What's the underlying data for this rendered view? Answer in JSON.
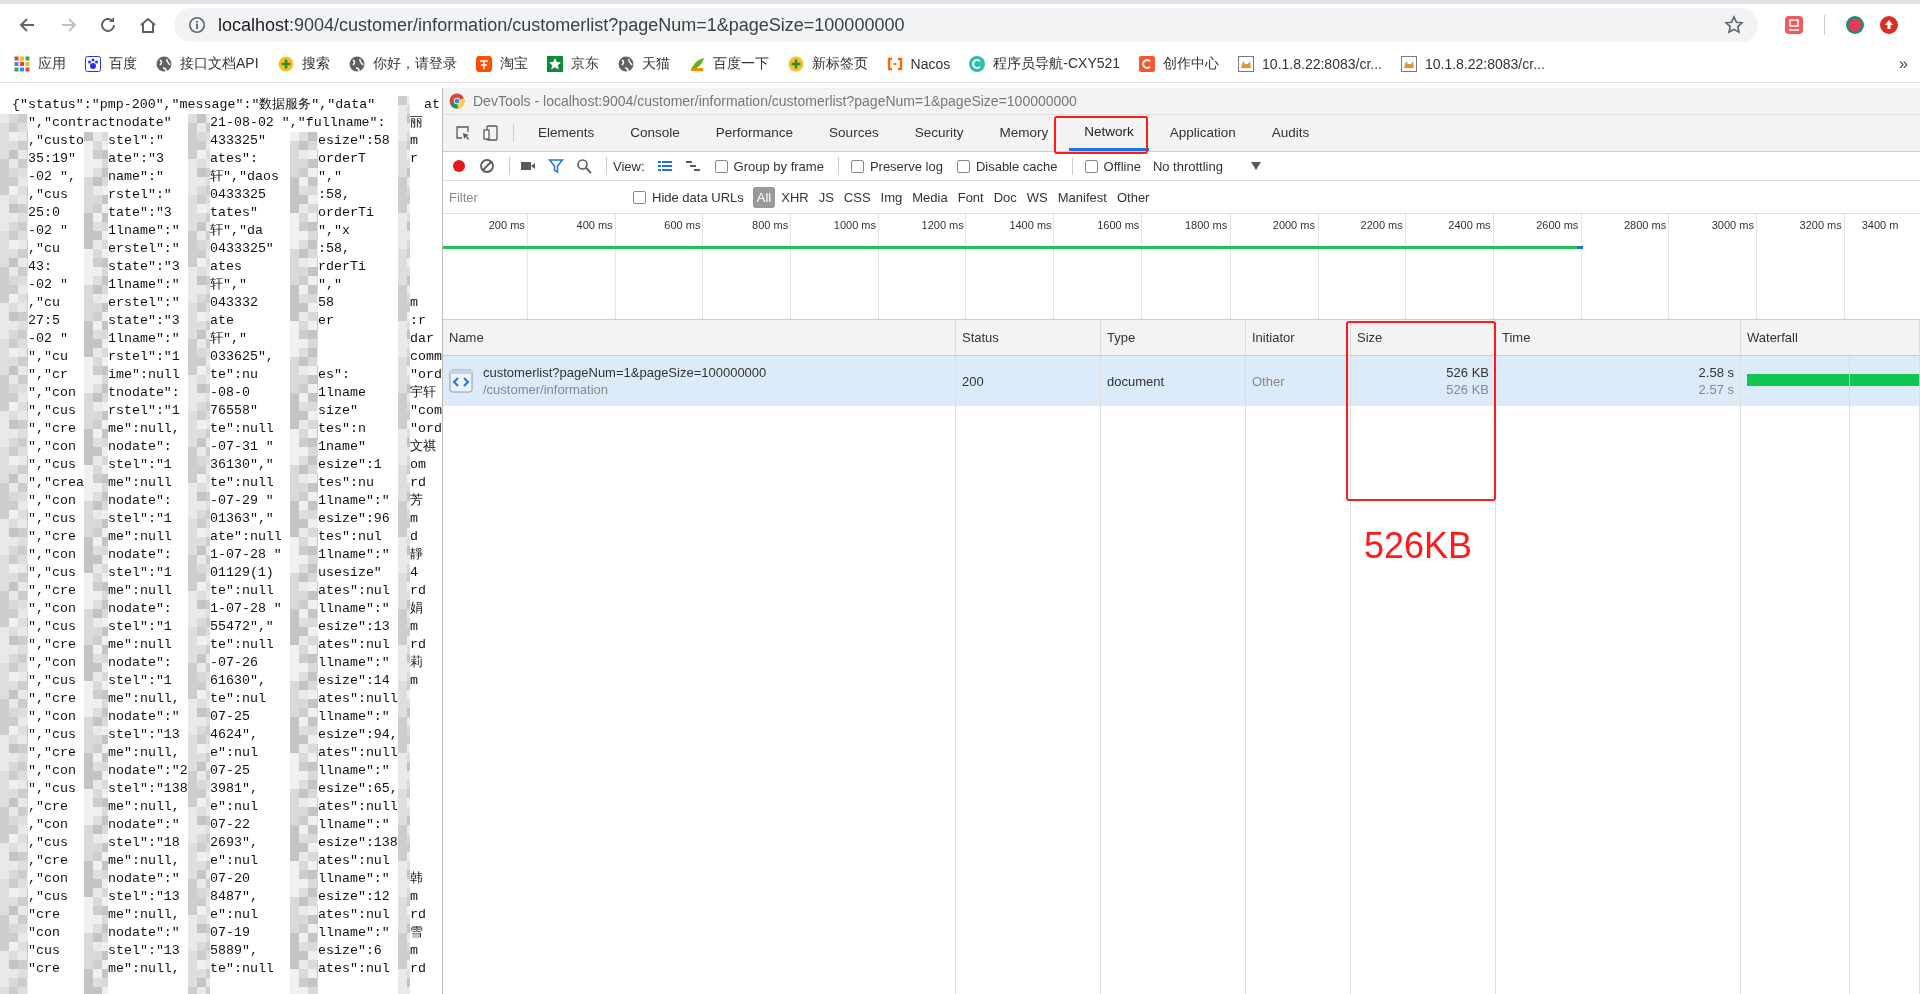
{
  "browser": {
    "url": {
      "host": "localhost",
      "path": ":9004/customer/information/customerlist?pageNum=1&pageSize=100000000"
    },
    "bookmarks": [
      {
        "label": "应用"
      },
      {
        "label": "百度"
      },
      {
        "label": "接口文档API"
      },
      {
        "label": "搜索"
      },
      {
        "label": "你好，请登录"
      },
      {
        "label": "淘宝"
      },
      {
        "label": "京东"
      },
      {
        "label": "天猫"
      },
      {
        "label": "百度一下"
      },
      {
        "label": "新标签页"
      },
      {
        "label": "Nacos"
      },
      {
        "label": "程序员导航-CXY521"
      },
      {
        "label": "创作中心"
      },
      {
        "label": "10.1.8.22:8083/cr..."
      },
      {
        "label": "10.1.8.22:8083/cr..."
      }
    ],
    "bookmarks_overflow": "»"
  },
  "page_json": {
    "head": "{\"status\":\"pmp-200\",\"message\":\"数据服务\",\"data\"",
    "head_tail": "at",
    "rows": [
      [
        "\",\"contractnodate\"",
        null,
        "21-08-02 \",\"fullname\":",
        null,
        "丽"
      ],
      [
        ",\"custo",
        "stel\":\"",
        "433325\"",
        "esize\":58",
        "m"
      ],
      [
        "35:19\"",
        "ate\":\"3",
        "ates\":",
        "orderT",
        "r"
      ],
      [
        "-02 \",",
        "name\":\"",
        "轩\",\"daos",
        "\",\"",
        null
      ],
      [
        ",\"cus",
        "rstel\":\"",
        "0433325",
        ":58,",
        null
      ],
      [
        "25:0",
        "tate\":\"3",
        "tates\"",
        "orderTi",
        null
      ],
      [
        "-02 \"",
        "1lname\":\"",
        "轩\",\"da",
        "\",\"x",
        null
      ],
      [
        ",\"cu",
        "erstel\":\"",
        "0433325\"",
        ":58,",
        null
      ],
      [
        "43:",
        "state\":\"3",
        "ates",
        "rderTi",
        null
      ],
      [
        "-02 \"",
        "1lname\":\"",
        "轩\",\"",
        "\",\"",
        null
      ],
      [
        ",\"cu",
        "erstel\":\"",
        "043332",
        "58",
        "m"
      ],
      [
        "27:5",
        "state\":\"3",
        "ate",
        "er",
        ":r"
      ],
      [
        "-02 \"",
        "1lname\":\"",
        "轩\",\"",
        null,
        "dar"
      ],
      [
        "\",\"cu",
        "rstel\":\"1",
        "033625\",",
        null,
        "comm"
      ],
      [
        "\",\"cr",
        "ime\":null",
        "te\":nu",
        "es\":",
        "\"ord"
      ],
      [
        "\",\"con",
        "tnodate\":",
        "-08-0",
        "1lname",
        "宇轩"
      ],
      [
        "\",\"cus",
        "rstel\":\"1",
        "76558\"",
        "size\"",
        "\"com"
      ],
      [
        "\",\"cre",
        "me\":null,",
        "te\":null",
        "tes\":n",
        "\"ord"
      ],
      [
        "\",\"con",
        "nodate\":",
        "-07-31 \"",
        "1name\"",
        "文祺"
      ],
      [
        "\",\"cus",
        "stel\":\"1",
        "36130\",\"",
        "esize\":1",
        "om"
      ],
      [
        "\",\"crea",
        "me\":null",
        "te\":null",
        "tes\":nu",
        "rd"
      ],
      [
        "\",\"con",
        "nodate\":",
        "-07-29 \"",
        "1lname\":\"",
        "芳"
      ],
      [
        "\",\"cus",
        "stel\":\"1",
        "01363\",\"",
        "esize\":96",
        "m"
      ],
      [
        "\",\"cre",
        "me\":null",
        "ate\":null",
        "tes\":nul",
        "d"
      ],
      [
        "\",\"con",
        "nodate\":",
        "1-07-28 \"",
        "1lname\":\"",
        "靜"
      ],
      [
        "\",\"cus",
        "stel\":\"1",
        "01129(1)",
        "usesize\"",
        "4"
      ],
      [
        "\",\"cre",
        "me\":null",
        "te\":null",
        "ates\":nul",
        "rd"
      ],
      [
        "\",\"con",
        "nodate\":",
        "1-07-28 \"",
        "llname\":\"",
        "娟"
      ],
      [
        "\",\"cus",
        "stel\":\"1",
        "55472\",\"",
        "esize\":13",
        "m"
      ],
      [
        "\",\"cre",
        "me\":null",
        "te\":null",
        "ates\":nul",
        "rd"
      ],
      [
        "\",\"con",
        "nodate\":",
        "-07-26",
        "llname\":\"",
        "莉"
      ],
      [
        "\",\"cus",
        "stel\":\"1",
        "61630\",",
        "esize\":14",
        "m"
      ],
      [
        "\",\"cre",
        "me\":null,",
        "te\":nul",
        "ates\":null",
        null
      ],
      [
        "\",\"con",
        "nodate\":\"",
        "07-25",
        "llname\":\"",
        null
      ],
      [
        "\",\"cus",
        "stel\":\"13",
        "4624\",",
        "esize\":94,",
        null
      ],
      [
        "\",\"cre",
        "me\":null,",
        "e\":nul",
        "ates\":null",
        null
      ],
      [
        "\",\"con",
        "nodate\":\"2",
        "07-25",
        "llname\":\"",
        null
      ],
      [
        "\",\"cus",
        "stel\":\"138",
        "3981\",",
        "esize\":65,",
        null
      ],
      [
        ",\"cre",
        "me\":null,",
        "e\":nul",
        "ates\":null",
        null
      ],
      [
        ",\"con",
        "nodate\":\"",
        "07-22",
        "llname\":\"",
        null
      ],
      [
        ",\"cus",
        "stel\":\"18",
        "2693\",",
        "esize\":138",
        null
      ],
      [
        ",\"cre",
        "me\":null,",
        "e\":nul",
        "ates\":nul",
        null
      ],
      [
        ",\"con",
        "nodate\":\"",
        "07-20",
        "llname\":\"",
        "韩"
      ],
      [
        ",\"cus",
        "stel\":\"13",
        "8487\",",
        "esize\":12",
        "m"
      ],
      [
        "\"cre",
        "me\":null,",
        "e\":nul",
        "ates\":nul",
        "rd"
      ],
      [
        "\"con",
        "nodate\":\"",
        "07-19",
        "llname\":\"",
        "雪"
      ],
      [
        "\"cus",
        "stel\":\"13",
        "5889\",",
        "esize\":6",
        "m"
      ],
      [
        "\"cre",
        "me\":null,",
        "te\":null",
        "ates\":nul",
        "rd"
      ]
    ]
  },
  "devtools": {
    "title": "DevTools - localhost:9004/customer/information/customerlist?pageNum=1&pageSize=100000000",
    "tabs": [
      {
        "label": "Elements",
        "selected": false
      },
      {
        "label": "Console",
        "selected": false
      },
      {
        "label": "Performance",
        "selected": false
      },
      {
        "label": "Sources",
        "selected": false
      },
      {
        "label": "Security",
        "selected": false
      },
      {
        "label": "Memory",
        "selected": false
      },
      {
        "label": "Network",
        "selected": true
      },
      {
        "label": "Application",
        "selected": false
      },
      {
        "label": "Audits",
        "selected": false
      }
    ],
    "toolbar": {
      "recording": true,
      "view_label": "View:",
      "group_by_frame": {
        "label": "Group by frame",
        "checked": false
      },
      "preserve_log": {
        "label": "Preserve log",
        "checked": false
      },
      "disable_cache": {
        "label": "Disable cache",
        "checked": false
      },
      "offline": {
        "label": "Offline",
        "checked": false
      },
      "throttling": "No throttling"
    },
    "filter": {
      "placeholder": "Filter",
      "hide_data_urls": {
        "label": "Hide data URLs",
        "checked": false
      },
      "types": [
        {
          "label": "All",
          "selected": true
        },
        {
          "label": "XHR",
          "selected": false
        },
        {
          "label": "JS",
          "selected": false
        },
        {
          "label": "CSS",
          "selected": false
        },
        {
          "label": "Img",
          "selected": false
        },
        {
          "label": "Media",
          "selected": false
        },
        {
          "label": "Font",
          "selected": false
        },
        {
          "label": "Doc",
          "selected": false
        },
        {
          "label": "WS",
          "selected": false
        },
        {
          "label": "Manifest",
          "selected": false
        },
        {
          "label": "Other",
          "selected": false
        }
      ]
    },
    "timeline_ticks": [
      "200 ms",
      "400 ms",
      "600 ms",
      "800 ms",
      "1000 ms",
      "1200 ms",
      "1400 ms",
      "1600 ms",
      "1800 ms",
      "2000 ms",
      "2200 ms",
      "2400 ms",
      "2600 ms",
      "2800 ms",
      "3000 ms",
      "3200 ms",
      "3400 m"
    ],
    "table": {
      "columns": [
        "Name",
        "Status",
        "Type",
        "Initiator",
        "Size",
        "Time",
        "Waterfall"
      ],
      "rows": [
        {
          "name": "customerlist?pageNum=1&pageSize=100000000",
          "path": "/customer/information",
          "status": "200",
          "type": "document",
          "initiator": "Other",
          "size": "526 KB",
          "resource_size": "526 KB",
          "time": "2.58 s",
          "latency": "2.57 s",
          "selected": true
        }
      ]
    }
  },
  "annotation": {
    "text": "526KB"
  }
}
